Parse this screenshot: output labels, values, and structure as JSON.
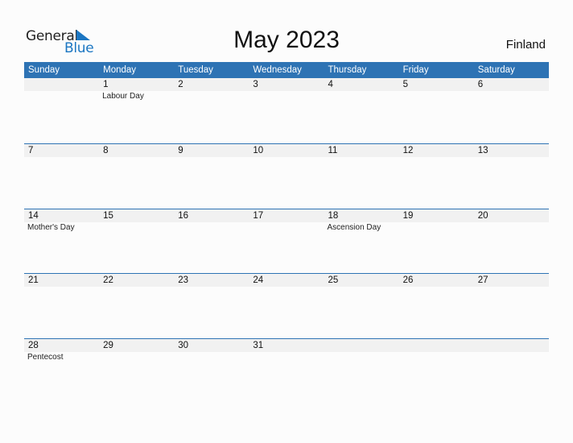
{
  "logo": {
    "word1": "General",
    "word2": "Blue",
    "icon": "triangle-logo-icon"
  },
  "title": "May 2023",
  "country": "Finland",
  "colors": {
    "accent": "#2e73b4",
    "band": "#f1f1f1",
    "logo_blue": "#1b76c2"
  },
  "weekdays": [
    "Sunday",
    "Monday",
    "Tuesday",
    "Wednesday",
    "Thursday",
    "Friday",
    "Saturday"
  ],
  "weeks": [
    [
      {
        "d": ""
      },
      {
        "d": "1",
        "h": "Labour Day"
      },
      {
        "d": "2"
      },
      {
        "d": "3"
      },
      {
        "d": "4"
      },
      {
        "d": "5"
      },
      {
        "d": "6"
      }
    ],
    [
      {
        "d": "7"
      },
      {
        "d": "8"
      },
      {
        "d": "9"
      },
      {
        "d": "10"
      },
      {
        "d": "11"
      },
      {
        "d": "12"
      },
      {
        "d": "13"
      }
    ],
    [
      {
        "d": "14",
        "h": "Mother's Day"
      },
      {
        "d": "15"
      },
      {
        "d": "16"
      },
      {
        "d": "17"
      },
      {
        "d": "18",
        "h": "Ascension Day"
      },
      {
        "d": "19"
      },
      {
        "d": "20"
      }
    ],
    [
      {
        "d": "21"
      },
      {
        "d": "22"
      },
      {
        "d": "23"
      },
      {
        "d": "24"
      },
      {
        "d": "25"
      },
      {
        "d": "26"
      },
      {
        "d": "27"
      }
    ],
    [
      {
        "d": "28",
        "h": "Pentecost"
      },
      {
        "d": "29"
      },
      {
        "d": "30"
      },
      {
        "d": "31"
      },
      {
        "d": ""
      },
      {
        "d": ""
      },
      {
        "d": ""
      }
    ]
  ]
}
